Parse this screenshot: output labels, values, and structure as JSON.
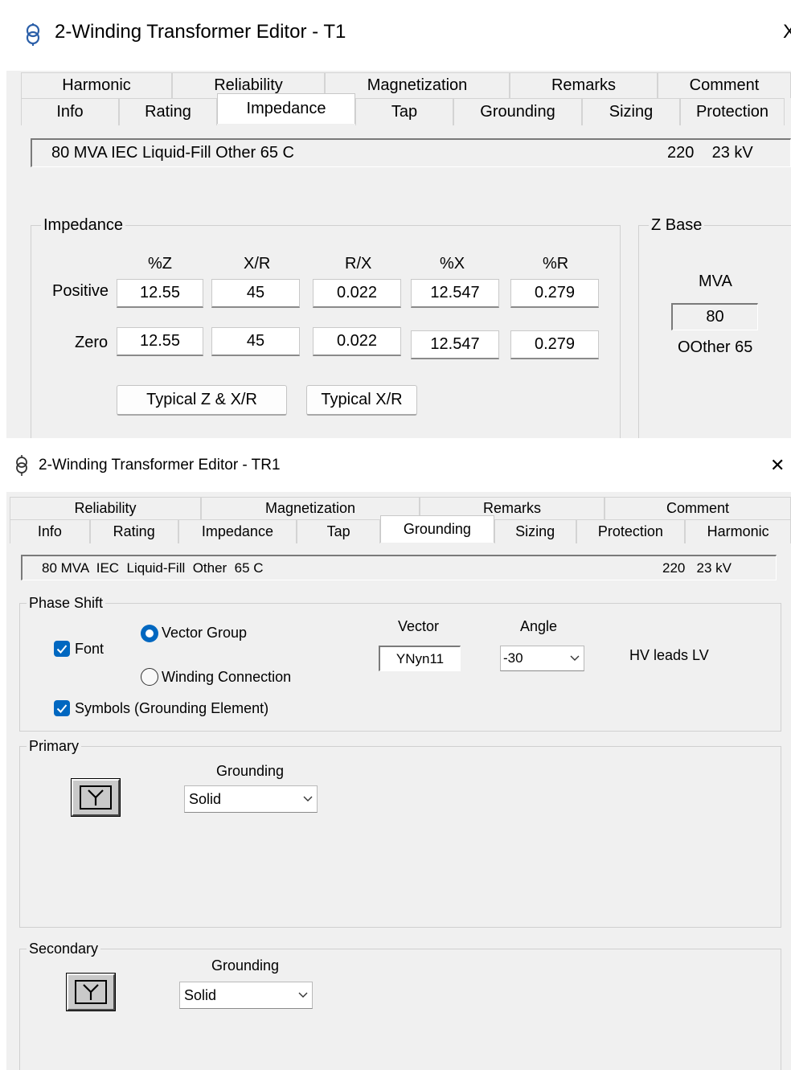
{
  "window1": {
    "title": "2-Winding Transformer Editor - T1",
    "close_glyph": "X",
    "tabs_row1": [
      "Harmonic",
      "Reliability",
      "Magnetization",
      "Remarks",
      "Comment"
    ],
    "tabs_row2": [
      "Info",
      "Rating",
      "Impedance",
      "Tap",
      "Grounding",
      "Sizing",
      "Protection"
    ],
    "active_tab": "Impedance",
    "desc_left": "80 MVA  IEC  Liquid-Fill  Other  65 C",
    "desc_right": "220    23 kV",
    "impedance": {
      "group_label": "Impedance",
      "columns": [
        "%Z",
        "X/R",
        "R/X",
        "%X",
        "%R"
      ],
      "rows": [
        {
          "label": "Positive",
          "values": [
            "12.55",
            "45",
            "0.022",
            "12.547",
            "0.279"
          ]
        },
        {
          "label": "Zero",
          "values": [
            "12.55",
            "45",
            "0.022",
            "12.547",
            "0.279"
          ]
        }
      ],
      "btn_typical_z": "Typical Z & X/R",
      "btn_typical_xr": "Typical  X/R"
    },
    "zbase": {
      "group_label": "Z Base",
      "mva_label": "MVA",
      "mva_value": "80",
      "note": "OOther 65"
    }
  },
  "window2": {
    "title": "2-Winding Transformer Editor - TR1",
    "close_glyph": "✕",
    "tabs_row1": [
      "Reliability",
      "Magnetization",
      "Remarks",
      "Comment"
    ],
    "tabs_row2": [
      "Info",
      "Rating",
      "Impedance",
      "Tap",
      "Grounding",
      "Sizing",
      "Protection",
      "Harmonic"
    ],
    "active_tab": "Grounding",
    "desc_left": "80 MVA  IEC  Liquid-Fill  Other  65 C",
    "desc_right": "220   23 kV",
    "phase_shift": {
      "group_label": "Phase Shift",
      "font_label": "Font",
      "font_checked": true,
      "vector_group_label": "Vector Group",
      "winding_connection_label": "Winding Connection",
      "selected_option": "Vector Group",
      "symbols_label": "Symbols (Grounding Element)",
      "symbols_checked": true,
      "vector_label": "Vector",
      "vector_value": "YNyn11",
      "angle_label": "Angle",
      "angle_value": "-30",
      "leads_text": "HV leads LV"
    },
    "primary": {
      "group_label": "Primary",
      "grounding_label": "Grounding",
      "grounding_value": "Solid",
      "symbol": "Y"
    },
    "secondary": {
      "group_label": "Secondary",
      "grounding_label": "Grounding",
      "grounding_value": "Solid",
      "symbol": "Y"
    }
  }
}
